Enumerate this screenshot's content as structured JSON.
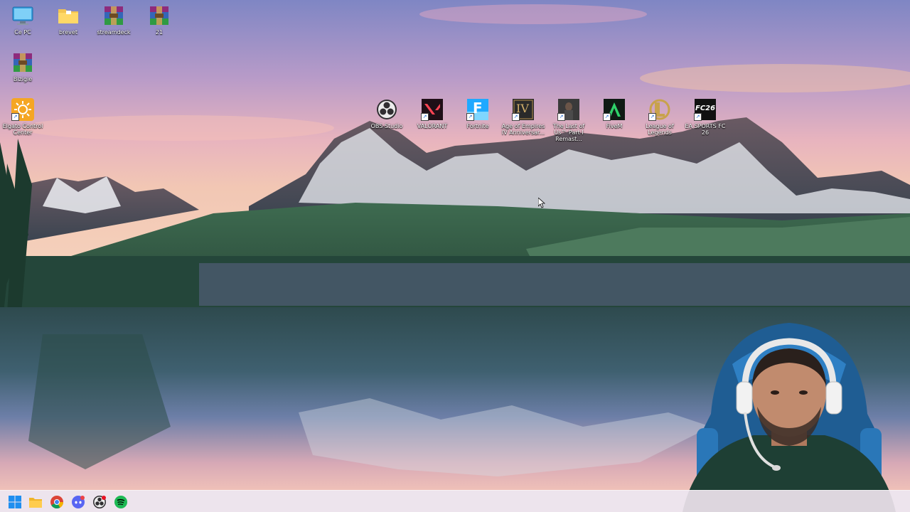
{
  "desktop": {
    "icons": [
      {
        "name": "computer-icon",
        "label": "Ce PC"
      },
      {
        "name": "folder-icon",
        "label": "brevet"
      },
      {
        "name": "winrar-archive-icon",
        "label": "streamdeck"
      },
      {
        "name": "winrar-archive-icon",
        "label": "21"
      },
      {
        "name": "winrar-archive-icon",
        "label": "Bizigie"
      },
      {
        "name": "elgato-control-center-icon",
        "label": "Elgato Control Center"
      },
      {
        "name": "obs-studio-icon",
        "label": "OBS Studio"
      },
      {
        "name": "valorant-icon",
        "label": "VALORANT"
      },
      {
        "name": "fortnite-icon",
        "label": "Fortnite"
      },
      {
        "name": "age-of-empires-icon",
        "label": "Age of Empires IV Anniversar..."
      },
      {
        "name": "the-last-of-us-icon",
        "label": "The Last of Us™ Part I Remast..."
      },
      {
        "name": "fivem-icon",
        "label": "FiveM"
      },
      {
        "name": "league-of-legends-icon",
        "label": "League of Legends"
      },
      {
        "name": "ea-sports-fc-icon",
        "label": "EA SPORTS FC 26"
      }
    ],
    "icon_glyphs": {
      "aoe": "IV",
      "fortnite": "F",
      "fc": "FC26",
      "league": "L"
    }
  },
  "taskbar": {
    "items": [
      {
        "name": "windows-start-icon"
      },
      {
        "name": "file-explorer-icon"
      },
      {
        "name": "chrome-icon"
      },
      {
        "name": "discord-icon"
      },
      {
        "name": "obs-studio-icon"
      },
      {
        "name": "spotify-icon"
      }
    ]
  },
  "colors": {
    "taskbar_bg": "#ece2ec",
    "icon_label": "#ffffff",
    "valorant": "#fa4454",
    "fortnite": "#1fa9ff",
    "spotify": "#1db954",
    "discord": "#5865f2"
  },
  "overlay": {
    "webcam": "webcam-overlay"
  }
}
